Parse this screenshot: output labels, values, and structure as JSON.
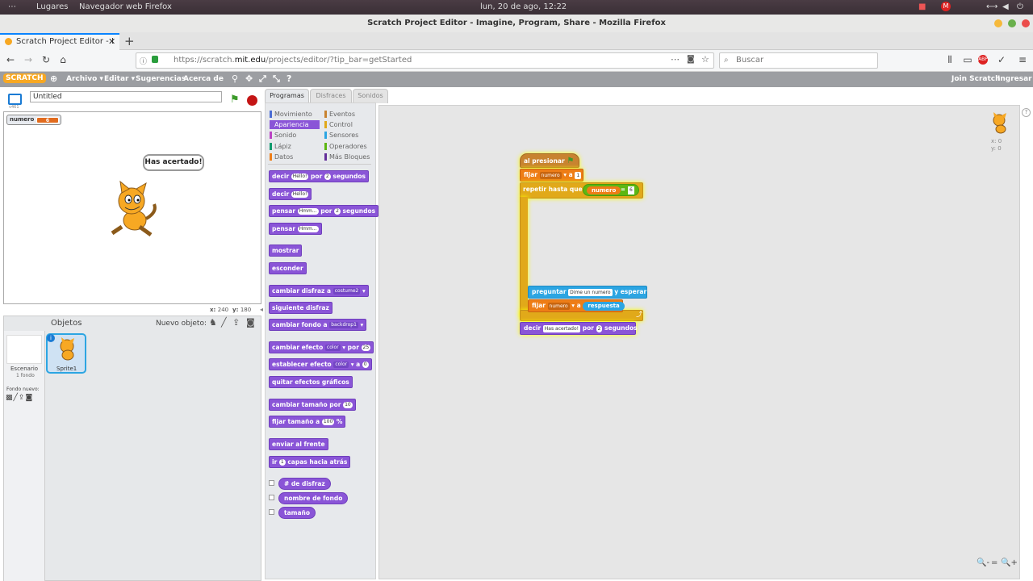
{
  "topbar": {
    "activities": "⋯",
    "places": "Lugares",
    "app": "Navegador web Firefox",
    "clock": "lun, 20 de ago, 12:22"
  },
  "window": {
    "title": "Scratch Project Editor - Imagine, Program, Share - Mozilla Firefox"
  },
  "tab": {
    "label": "Scratch Project Editor - I"
  },
  "nav": {
    "url_prefix": "https://scratch.",
    "url_domain": "mit.edu",
    "url_path": "/projects/editor/?tip_bar=getStarted",
    "search_placeholder": "Buscar"
  },
  "scratch_menu": {
    "logo": "SCRATCH",
    "archivo": "Archivo ▾",
    "editar": "Editar ▾",
    "sugerencias": "Sugerencias",
    "acerca": "Acerca de",
    "join": "Join Scratch",
    "ingresar": "Ingresar ▾"
  },
  "stage": {
    "version": "v461",
    "project_title": "Untitled",
    "variable_name": "numero",
    "variable_value": "6",
    "speech": "Has acertado!",
    "coords_x_label": "x:",
    "coords_x": "240",
    "coords_y_label": "y:",
    "coords_y": "180"
  },
  "sprites": {
    "header": "Objetos",
    "new_sprite": "Nuevo objeto:",
    "stage_label": "Escenario",
    "stage_sub": "1 fondo",
    "new_backdrop": "Fondo nuevo:",
    "sprite_name": "Sprite1"
  },
  "palette_tabs": [
    "Programas",
    "Disfraces",
    "Sonidos"
  ],
  "categories": {
    "left": [
      {
        "label": "Movimiento",
        "color": "#4a6cd4"
      },
      {
        "label": "Apariencia",
        "color": "#8a55d7"
      },
      {
        "label": "Sonido",
        "color": "#bb42c3"
      },
      {
        "label": "Lápiz",
        "color": "#0e9a6c"
      },
      {
        "label": "Datos",
        "color": "#ee7d16"
      }
    ],
    "right": [
      {
        "label": "Eventos",
        "color": "#c88330"
      },
      {
        "label": "Control",
        "color": "#e1a91a"
      },
      {
        "label": "Sensores",
        "color": "#2ca5e2"
      },
      {
        "label": "Operadores",
        "color": "#5cb712"
      },
      {
        "label": "Más Bloques",
        "color": "#632d99"
      }
    ]
  },
  "blocks": {
    "say_for": {
      "a": "decir",
      "slot": "Hello!",
      "b": "por",
      "num": "2",
      "c": "segundos"
    },
    "say": {
      "a": "decir",
      "slot": "Hello!"
    },
    "think_for": {
      "a": "pensar",
      "slot": "Hmm...",
      "b": "por",
      "num": "2",
      "c": "segundos"
    },
    "think": {
      "a": "pensar",
      "slot": "Hmm..."
    },
    "show": "mostrar",
    "hide": "esconder",
    "switch_costume": {
      "a": "cambiar disfraz a",
      "drop": "costume2"
    },
    "next_costume": "siguiente disfraz",
    "switch_backdrop": {
      "a": "cambiar fondo a",
      "drop": "backdrop1"
    },
    "change_effect": {
      "a": "cambiar efecto",
      "drop": "color",
      "b": "por",
      "num": "25"
    },
    "set_effect": {
      "a": "establecer efecto",
      "drop": "color",
      "b": "a",
      "num": "0"
    },
    "clear_effects": "quitar efectos gráficos",
    "change_size": {
      "a": "cambiar tamaño por",
      "num": "10"
    },
    "set_size": {
      "a": "fijar tamaño a",
      "num": "100",
      "b": "%"
    },
    "front": "enviar al frente",
    "back_layers": {
      "a": "ir",
      "num": "1",
      "b": "capas hacia atrás"
    },
    "costume_num": "# de disfraz",
    "backdrop_name": "nombre de fondo",
    "size": "tamaño"
  },
  "script": {
    "hat": "al presionar",
    "set1": {
      "a": "fijar",
      "drop": "numero",
      "b": "a",
      "slot": "1"
    },
    "repeat": {
      "a": "repetir hasta que",
      "var": "numero",
      "op": "=",
      "val": "6"
    },
    "ask": {
      "a": "preguntar",
      "slot": "Dime un numero",
      "b": "y esperar"
    },
    "set2": {
      "a": "fijar",
      "drop": "numero",
      "b": "a",
      "reporter": "respuesta"
    },
    "say": {
      "a": "decir",
      "slot": "Has acertado!",
      "b": "por",
      "num": "2",
      "c": "segundos"
    }
  },
  "sprite_info": {
    "x": "x: 0",
    "y": "y: 0"
  },
  "zoom": {
    "out": "🔍-",
    "reset": "=",
    "in": "🔍+"
  }
}
